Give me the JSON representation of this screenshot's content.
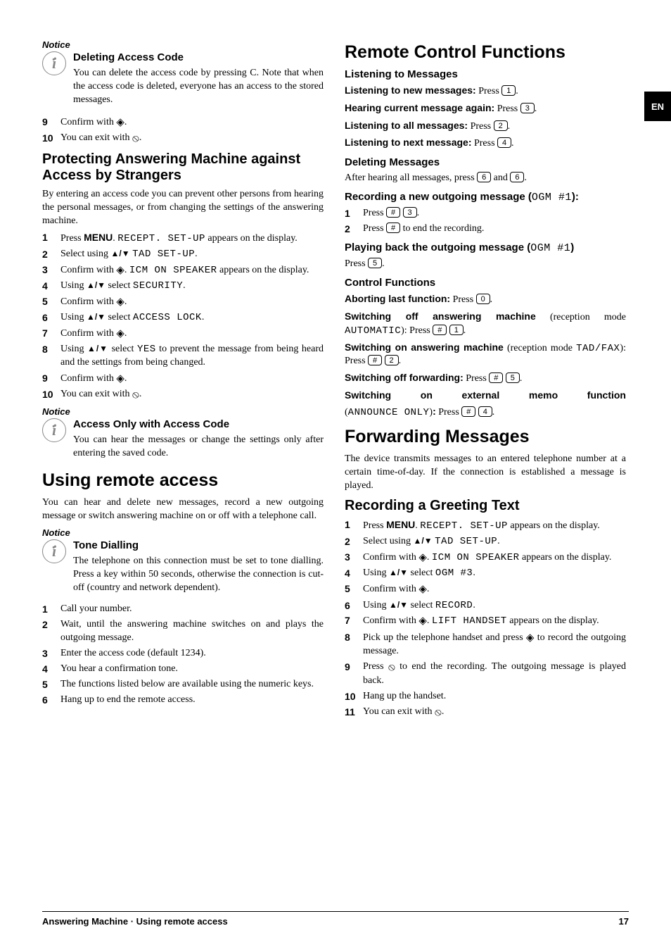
{
  "lang_tab": "EN",
  "footer": {
    "left": "Answering Machine · Using remote access",
    "right": "17"
  },
  "left": {
    "notice1_label": "Notice",
    "notice1_title": "Deleting Access Code",
    "notice1_body": "You can delete the access code by pressing C. Note that when the access code is deleted, everyone has an access to the stored messages.",
    "step9": "Confirm with ",
    "step10a": "You can exit with ",
    "h2a": "Protecting Answering Machine against Access by Strangers",
    "p1": "By entering an access code you can prevent other persons from hearing the personal messages, or from changing the settings of the answering machine.",
    "s1a": "Press ",
    "s1b": ". ",
    "s1c": " appears on the display.",
    "menu": "MENU",
    "recept_setup": "RECEPT. SET-UP",
    "s2a": "Select using ",
    "s2b": " ",
    "tad_setup": "TAD SET-UP",
    "s3a": "Confirm with ",
    "s3b": ". ",
    "icm": "ICM ON SPEAKER",
    "s3c": " appears on the display.",
    "s4a": "Using ",
    "s4b": " select ",
    "security": "SECURITY",
    "s5": "Confirm with ",
    "s6a": "Using ",
    "s6b": " select ",
    "access_lock": "ACCESS LOCK",
    "s7": "Confirm with ",
    "s8a": "Using ",
    "s8b": " select ",
    "yes": "YES",
    "s8c": " to prevent the message from being heard and the settings from being changed.",
    "s9": "Confirm with ",
    "s10": "You can exit with ",
    "notice2_label": "Notice",
    "notice2_title": "Access Only with Access Code",
    "notice2_body": "You can hear the messages or change the settings only after entering the saved code.",
    "h1b": "Using remote access",
    "p2": "You can hear and delete new messages, record a new outgoing message or switch answering machine on or off with a telephone call.",
    "notice3_label": "Notice",
    "notice3_title": "Tone Dialling",
    "notice3_body": "The telephone on this connection must be set to tone dialling. Press a key within 50 seconds, otherwise the connection is cut-off (country and network dependent).",
    "r1": "Call your number.",
    "r2": "Wait, until the answering machine switches on and plays the outgoing message.",
    "r3": "Enter the access code (default 1234).",
    "r4": "You hear a confirmation tone.",
    "r5": "The functions listed below are available using the numeric keys.",
    "r6": "Hang up to end the remote access."
  },
  "right": {
    "h1a": "Remote Control Functions",
    "h3a": "Listening to Messages",
    "lm1a": "Listening to new messages:",
    "lm1b": " Press ",
    "lm2a": "Hearing current message again:",
    "lm2b": " Press ",
    "lm3a": "Listening to all messages:",
    "lm3b": " Press ",
    "lm4a": "Listening to next message:",
    "lm4b": " Press ",
    "h3b": "Deleting Messages",
    "dm": "After hearing all messages, press ",
    "dm2": " and ",
    "h3c_a": "Recording a new outgoing message (",
    "ogm": "OGM #1",
    "h3c_b": "):",
    "rec1": "Press ",
    "rec2a": "Press ",
    "rec2b": " to end the recording.",
    "h3d_a": "Playing back the outgoing message (",
    "h3d_b": ")",
    "play": "Press ",
    "h3e": "Control Functions",
    "cf1a": "Aborting last function:",
    "cf1b": " Press ",
    "cf2a": "Switching off answering machine",
    "cf2b": "  (reception mode ",
    "automatic": "AUTOMATIC",
    "cf2c": "): Press ",
    "cf3a": "Switching on answering machine",
    "cf3b": "  (reception mode ",
    "tadfax": "TAD/FAX",
    "cf3c": "): Press ",
    "cf4a": "Switching off forwarding:",
    "cf4b": " Press ",
    "cf5a": "Switching on external memo function",
    "cf5b": " (",
    "announce": "ANNOUNCE ONLY",
    "cf5c": "): Press ",
    "h1b": "Forwarding Messages",
    "fp": "The device transmits messages to an entered telephone number at a certain time-of-day. If the connection is established a message is played.",
    "h2r": "Recording a Greeting Text",
    "g1a": "Press ",
    "g1b": ". ",
    "g1c": " appears on the display.",
    "g2a": "Select using ",
    "g2b": " ",
    "g3a": "Confirm with ",
    "g3b": ". ",
    "g3c": " appears on the display.",
    "g4a": "Using ",
    "g4b": " select ",
    "ogm3": "OGM #3",
    "g5": "Confirm with ",
    "g6a": "Using ",
    "g6b": " select ",
    "record": "RECORD",
    "g7a": "Confirm with ",
    "g7b": ". ",
    "lift": "LIFT HANDSET",
    "g7c": " appears on the display.",
    "g8a": "Pick up the telephone handset and press ",
    "g8b": " to record the outgoing message.",
    "g9a": "Press ",
    "g9b": " to end the recording. The outgoing message is played back.",
    "g10": "Hang up the handset.",
    "g11": "You can exit with "
  }
}
